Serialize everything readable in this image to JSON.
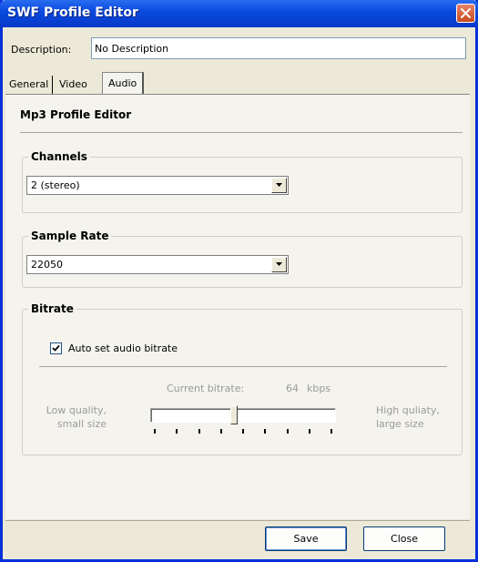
{
  "window": {
    "title": "SWF Profile Editor"
  },
  "description": {
    "label": "Description:",
    "value": "No Description"
  },
  "tabs": [
    {
      "label": "General"
    },
    {
      "label": "Video"
    },
    {
      "label": "Audio",
      "selected": true
    }
  ],
  "panel": {
    "title": "Mp3 Profile Editor"
  },
  "channels": {
    "legend": "Channels",
    "selected": "2 (stereo)"
  },
  "sample_rate": {
    "legend": "Sample Rate",
    "selected": "22050"
  },
  "bitrate": {
    "legend": "Bitrate",
    "auto_checkbox": {
      "label": "Auto set audio bitrate",
      "checked": true
    },
    "current_label": "Current bitrate:",
    "current_value": "64",
    "unit": "kbps",
    "low_label_1": "Low quality,",
    "low_label_2": "small size",
    "high_label_1": "High quliaty,",
    "high_label_2": "large size",
    "slider_fraction": 0.45,
    "enabled": false
  },
  "buttons": {
    "save": "Save",
    "close": "Close"
  },
  "colors": {
    "titlebar": "#0a4be0",
    "window_face": "#ece9d8",
    "panel_face": "#f4f3ee",
    "disabled_text": "#9a9a9a",
    "close_button": "#c84a1e"
  },
  "icons": {
    "close": "close-icon",
    "dropdown": "chevron-down-icon",
    "check": "check-icon"
  }
}
